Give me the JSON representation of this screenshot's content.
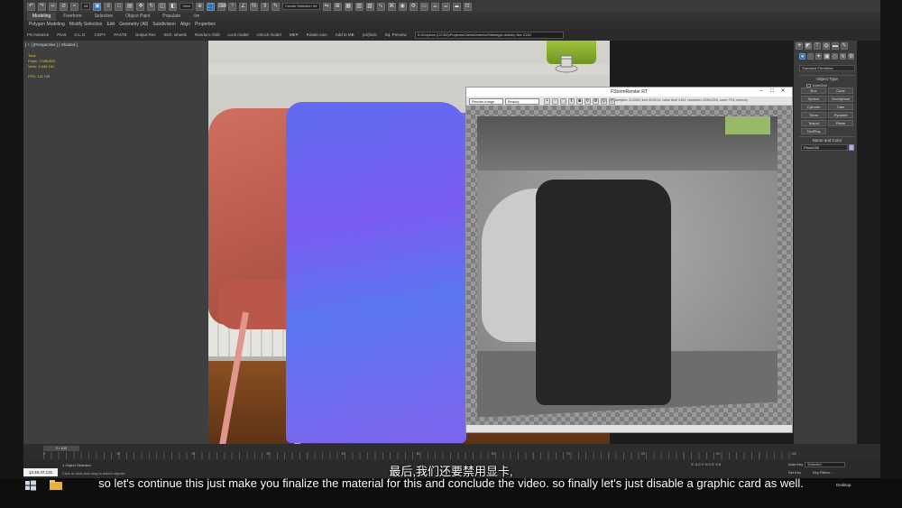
{
  "toolbar": {
    "undo": "undo-icon",
    "redo": "redo-icon",
    "filter_value": "All",
    "view_value": "View",
    "selection_set_placeholder": "Create Selection Se"
  },
  "ribbon": {
    "tabs": [
      "Modeling",
      "Freeform",
      "Selection",
      "Object Paint",
      "Populate"
    ],
    "menu": [
      "Polygon Modeling",
      "Modify Selection",
      "Edit",
      "Geometry (All)",
      "Subdivision",
      "Align",
      "Properties"
    ]
  },
  "commands": {
    "items": [
      "PS Instance",
      "Pivot",
      "G.L.O.",
      "COPY",
      "PASTE",
      "Output Res",
      "Stch. wheels",
      "Random child",
      "Lock model",
      "Unlock model",
      "MEP",
      "Rotate cam",
      "Add to MB",
      "(un)lock",
      "Sq. Preview"
    ],
    "path": "D:\\Dropbox (CC3D)\\Projects\\Clients\\Interior\\Stimings\\ dotisby flex 2130"
  },
  "viewport": {
    "label": "[ + ] [Perspective ] [ Shaded ]",
    "stats": {
      "total_label": "Total",
      "polys_label": "Polys:",
      "polys_value": "7,086,889",
      "verts_label": "Verts:",
      "verts_value": "3,646,161",
      "fps_label": "FPS:",
      "fps_value": "113.745"
    }
  },
  "fstorm": {
    "title": "FStormRender RT",
    "render_mode": "Render Image",
    "channel": "Beauty",
    "stats": "samples: 21/2000,  time 00:00:11,  noise level 4.811,  resolution 1200x1200,  zoom 71%,  memory"
  },
  "command_panel": {
    "dropdown": "Standard Primitives",
    "object_type_label": "Object Type",
    "autogrid_label": "AutoGrid",
    "objects": [
      "Box",
      "Cone",
      "Sphere",
      "GeoSphere",
      "Cylinder",
      "Tube",
      "Torus",
      "Pyramid",
      "Teapot",
      "Plane",
      "TextPlus"
    ],
    "name_color_label": "Name and Color",
    "name_value": "Plane258",
    "swatch_color": "#b6a7ff"
  },
  "timeline": {
    "slider_label": "0 / 100",
    "tick_labels": [
      "0",
      "10",
      "20",
      "30",
      "40",
      "50",
      "60",
      "70",
      "80",
      "90",
      "100"
    ]
  },
  "statusbar": {
    "clock": "12:45:47.131",
    "selection": "1 Object Selected",
    "hint": "Click or click-and-drag to select objects",
    "coord": "X: 0.0   Y: 0.0   Z: 0.0",
    "autokey": "Auto Key",
    "selected": "Selected",
    "setkey": "Set Key",
    "keyfilters": "Key Filters..."
  },
  "taskbar": {
    "desktop": "Desktop"
  },
  "subtitles": {
    "cn": "最后,我们还要禁用显卡,",
    "en": "so let's continue this just make you finalize the material for this and conclude the video. so finally let's just disable a graphic card as well."
  }
}
